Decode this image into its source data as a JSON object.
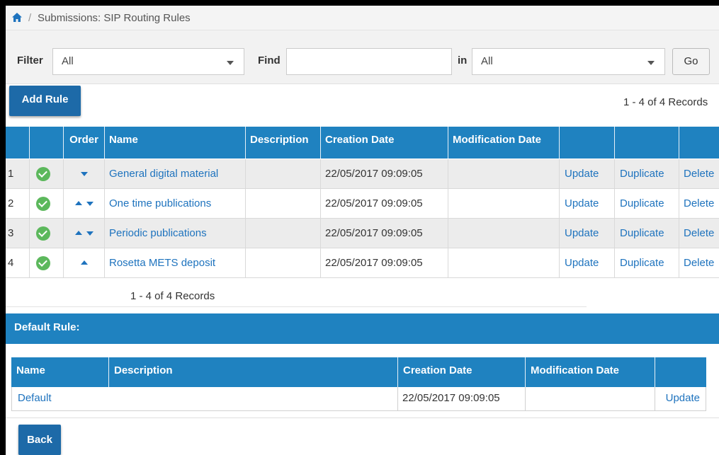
{
  "breadcrumb": {
    "separator": "/",
    "title": "Submissions: SIP Routing Rules"
  },
  "filterbar": {
    "filter_label": "Filter",
    "filter_value": "All",
    "find_label": "Find",
    "find_value": "",
    "in_label": "in",
    "in_value": "All",
    "go_label": "Go"
  },
  "toolbar": {
    "add_rule_label": "Add Rule",
    "records_top": "1 - 4 of 4 Records"
  },
  "table": {
    "headers": [
      "",
      "",
      "Order",
      "Name",
      "Description",
      "Creation Date",
      "Modification Date",
      "",
      "",
      ""
    ],
    "rows": [
      {
        "num": "1",
        "name": "General digital material",
        "description": "",
        "created": "22/05/2017 09:09:05",
        "modified": "",
        "update": "Update",
        "duplicate": "Duplicate",
        "delete": "Delete"
      },
      {
        "num": "2",
        "name": "One time publications",
        "description": "",
        "created": "22/05/2017 09:09:05",
        "modified": "",
        "update": "Update",
        "duplicate": "Duplicate",
        "delete": "Delete"
      },
      {
        "num": "3",
        "name": "Periodic publications",
        "description": "",
        "created": "22/05/2017 09:09:05",
        "modified": "",
        "update": "Update",
        "duplicate": "Duplicate",
        "delete": "Delete"
      },
      {
        "num": "4",
        "name": "Rosetta METS deposit",
        "description": "",
        "created": "22/05/2017 09:09:05",
        "modified": "",
        "update": "Update",
        "duplicate": "Duplicate",
        "delete": "Delete"
      }
    ],
    "records_bottom": "1 - 4 of 4 Records"
  },
  "default_rule": {
    "title": "Default Rule:",
    "headers": [
      "Name",
      "Description",
      "Creation Date",
      "Modification Date",
      ""
    ],
    "row": {
      "name": "Default",
      "description": "",
      "created": "22/05/2017 09:09:05",
      "modified": "",
      "update": "Update"
    }
  },
  "footer": {
    "back_label": "Back"
  },
  "colors": {
    "header_blue": "#1f82c0",
    "button_blue": "#1d6aa8",
    "link_blue": "#1e73be",
    "status_green": "#5cb85c"
  },
  "icons": {
    "home": "home-icon",
    "status": "check-circle-icon",
    "order_up": "arrow-up-icon",
    "order_down": "arrow-down-icon",
    "dropdown": "chevron-down-icon"
  }
}
